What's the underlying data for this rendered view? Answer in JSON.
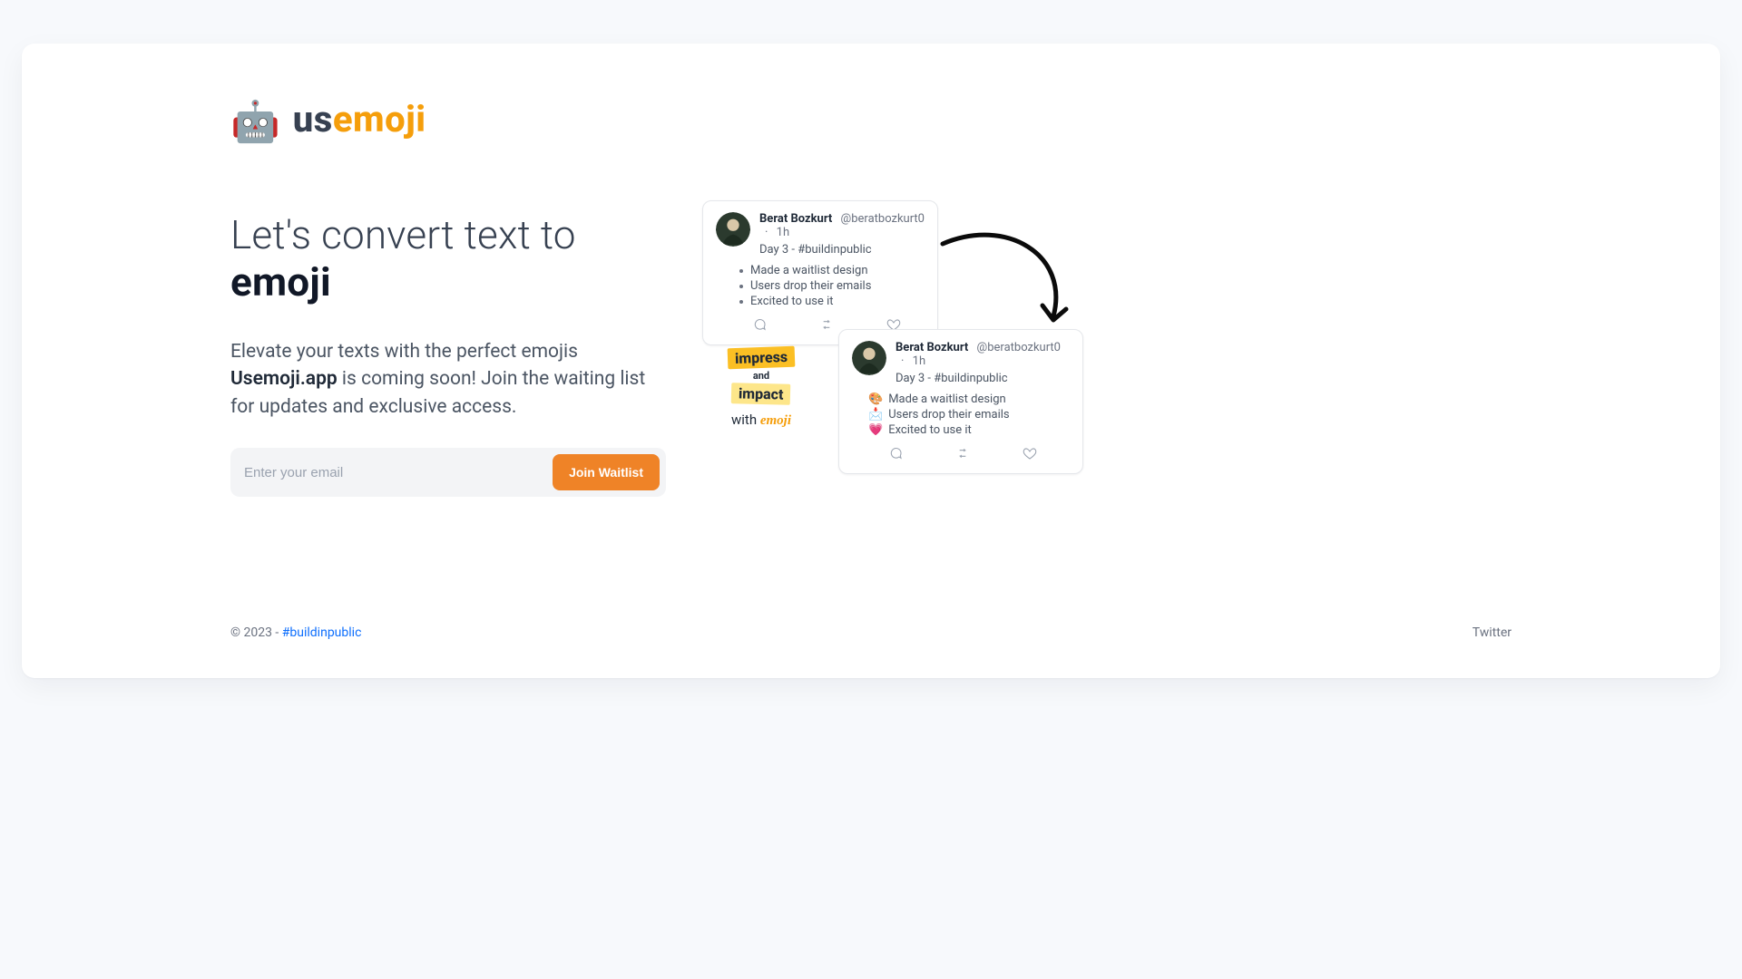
{
  "brand": {
    "icon_char": "🤖",
    "prefix": "us",
    "suffix": "emoji"
  },
  "hero": {
    "title_plain": "Let's convert text to ",
    "title_bold": "emoji",
    "line1": "Elevate your texts with the perfect emojis",
    "brand_inline": "Usemoji.app",
    "line2_rest": " is coming soon! Join the waiting list for updates and exclusive access."
  },
  "form": {
    "placeholder": "Enter your email",
    "button": "Join Waitlist"
  },
  "tweet_a": {
    "name": "Berat Bozkurt",
    "handle": "@beratbozkurt0",
    "time": "1h",
    "caption": "Day 3 - #buildinpublic",
    "items": [
      "Made a waitlist design",
      "Users drop their emails",
      "Excited to use it"
    ]
  },
  "tweet_b": {
    "name": "Berat Bozkurt",
    "handle": "@beratbozkurt0",
    "time": "1h",
    "caption": "Day 3 - #buildinpublic",
    "items": [
      {
        "emoji": "🎨",
        "text": "Made a waitlist design"
      },
      {
        "emoji": "📩",
        "text": "Users drop their emails"
      },
      {
        "emoji": "💗",
        "text": "Excited to use it"
      }
    ]
  },
  "slogan": {
    "w1": "impress",
    "and": "and",
    "w2": "impact",
    "with": "with",
    "emoji_word": "emoji"
  },
  "footer": {
    "copy": "© 2023 -",
    "hashtag": "#buildinpublic",
    "twitter": "Twitter"
  }
}
